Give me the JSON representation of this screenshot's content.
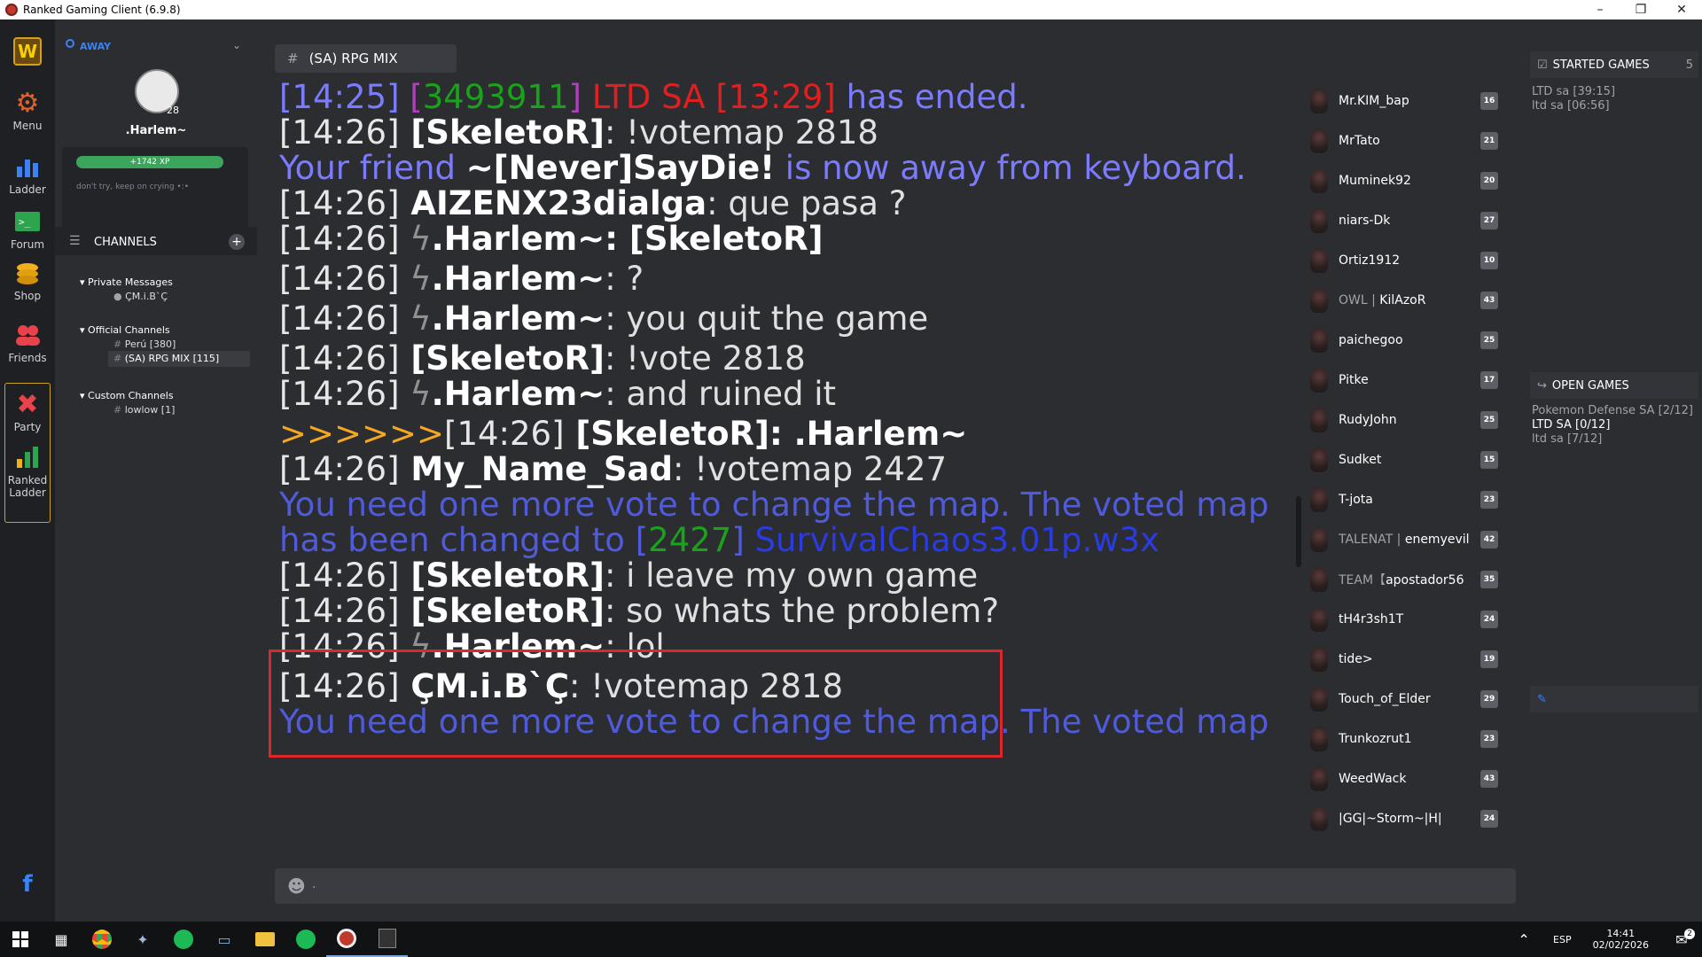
{
  "window": {
    "title": "Ranked Gaming Client (6.9.8)"
  },
  "nav": {
    "menu": "Menu",
    "ladder": "Ladder",
    "forum": "Forum",
    "shop": "Shop",
    "friends": "Friends",
    "party": "Party",
    "ranked_ladder_1": "Ranked",
    "ranked_ladder_2": "Ladder"
  },
  "profile": {
    "status": "AWAY",
    "level": "28",
    "name": ".Harlem~",
    "xp": "+1742 XP",
    "motto": "don't try, keep on crying •:•"
  },
  "channels": {
    "header": "CHANNELS",
    "private_label": "Private Messages",
    "private_items": [
      "ÇM.i.B`Ç"
    ],
    "official_label": "Official Channels",
    "official_items": [
      "Perú [380]",
      "(SA) RPG MIX [115]"
    ],
    "custom_label": "Custom Channels",
    "custom_items": [
      "lowlow [1]"
    ]
  },
  "chat": {
    "tab": "(SA) RPG MIX",
    "lines": [
      {
        "ts": "[14:25]",
        "p1": "[",
        "id": "3493911",
        "p2": "]",
        "game": " LTD SA [13:29]",
        "rest": " has ended."
      },
      {
        "ts": "[14:26]",
        "nick": " [SkeletoR]",
        "msg": ": !votemap 2818"
      },
      {
        "sys1": "Your friend ",
        "friend": "~[Never]SayDie!",
        "sys2": " is now away from keyboard."
      },
      {
        "ts": "[14:26]",
        "nick": " AIZENX23dialga",
        "msg": ": que pasa ?"
      },
      {
        "ts": "[14:26]",
        "bolt": " ϟ",
        "nick": ".Harlem~",
        "msg": ": [SkeletoR]"
      },
      {
        "ts": "[14:26]",
        "bolt": " ϟ",
        "nick": ".Harlem~",
        "msg": ": ?"
      },
      {
        "ts": "[14:26]",
        "bolt": " ϟ",
        "nick": ".Harlem~",
        "msg": ": you quit the game"
      },
      {
        "ts": "[14:26]",
        "nick": " [SkeletoR]",
        "msg": ": !vote 2818"
      },
      {
        "ts": "[14:26]",
        "bolt": " ϟ",
        "nick": ".Harlem~",
        "msg": ": and ruined it"
      },
      {
        "arrow": ">>>>>>",
        "ts": "[14:26]",
        "nick": " [SkeletoR]",
        "msg": ": .Harlem~"
      },
      {
        "ts": "[14:26]",
        "nick": " My_Name_Sad",
        "msg": ": !votemap 2427"
      },
      {
        "sys": "You need one more vote to change the map. The voted map"
      },
      {
        "sys": "has been changed to ",
        "p1": "[",
        "id": "2427",
        "p2": "]",
        "map": " SurvivalChaos3.01p.w3x"
      },
      {
        "ts": "[14:26]",
        "nick": " [SkeletoR]",
        "msg": ": i leave my own game"
      },
      {
        "ts": "[14:26]",
        "nick": " [SkeletoR]",
        "msg": ": so whats the problem?"
      },
      {
        "ts": "[14:26]",
        "bolt": " ϟ",
        "nick": ".Harlem~",
        "msg": ": lol"
      },
      {
        "ts": "[14:26]",
        "nick": " ÇM.i.B`Ç",
        "msg": ": !votemap 2818"
      },
      {
        "sys": "You need one more vote to change the map. The voted map"
      }
    ]
  },
  "users": [
    {
      "name": "Mr.KIM_bap",
      "lvl": "16"
    },
    {
      "name": "MrTato",
      "lvl": "21"
    },
    {
      "name": "Muminek92",
      "lvl": "20"
    },
    {
      "name": "niars-Dk",
      "lvl": "27"
    },
    {
      "name": "Ortiz1912",
      "lvl": "10"
    },
    {
      "clan": "OWL | ",
      "name": "KilAzoR",
      "lvl": "43"
    },
    {
      "name": "paichegoo",
      "lvl": "25"
    },
    {
      "name": "Pitke",
      "lvl": "17"
    },
    {
      "name": "RudyJohn",
      "lvl": "25"
    },
    {
      "name": "Sudket",
      "lvl": "15"
    },
    {
      "name": "T-jota",
      "lvl": "23"
    },
    {
      "clan": "TALENAT | ",
      "name": "enemyevil",
      "lvl": "42"
    },
    {
      "clan": "TEAM【",
      "name": "apostador56",
      "lvl": "35"
    },
    {
      "name": "tH4r3sh1T",
      "lvl": "24"
    },
    {
      "name": "tide>",
      "lvl": "19"
    },
    {
      "name": "Touch_of_Elder",
      "lvl": "29"
    },
    {
      "name": "Trunkozrut1",
      "lvl": "23"
    },
    {
      "name": "WeedWack",
      "lvl": "43"
    },
    {
      "name": "|GG|~Storm~|H|",
      "lvl": "24"
    }
  ],
  "started_games": {
    "header": "STARTED GAMES",
    "count": "5",
    "items": [
      "LTD sa [39:15]",
      "ltd sa [06:56]"
    ]
  },
  "open_games": {
    "header": "OPEN GAMES",
    "items": [
      "Pokemon Defense SA [2/12]",
      "LTD SA [0/12]",
      "ltd sa [7/12]"
    ]
  },
  "input": {
    "placeholder": "."
  },
  "tray": {
    "lang": "ESP",
    "time": "14:41",
    "date": "02/02/2026",
    "notif": "2"
  },
  "colors": {
    "accent_xp": "#3ba55c",
    "highlight_box": "#e0262d",
    "system_text": "#7b7bff",
    "link_blue": "#4f5bdb"
  }
}
